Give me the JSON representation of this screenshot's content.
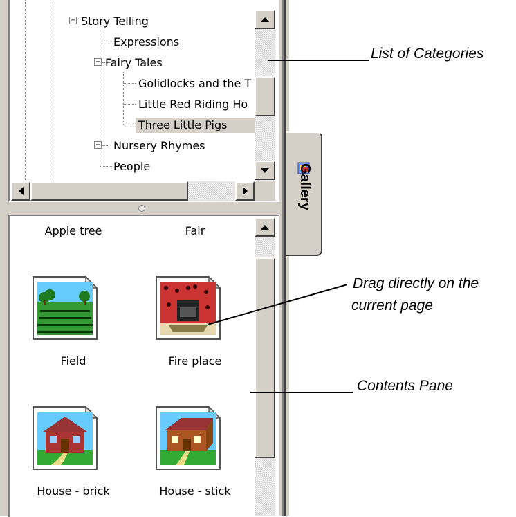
{
  "tree": {
    "items": [
      {
        "label": "Story Telling",
        "expander": "⊟"
      },
      {
        "label": "Expressions"
      },
      {
        "label": "Fairy Tales",
        "expander": "⊟"
      },
      {
        "label": "Golidlocks and the T"
      },
      {
        "label": "Little Red Riding Ho"
      },
      {
        "label": "Three Little Pigs",
        "selected": true
      },
      {
        "label": "Nursery Rhymes",
        "expander": "⊞"
      },
      {
        "label": "People"
      }
    ]
  },
  "gallery": {
    "tab_label": "Gallery",
    "tab_icon": "gallery-icon",
    "items": [
      {
        "caption": "Apple tree"
      },
      {
        "caption": "Fair"
      },
      {
        "caption": "Field",
        "icon": "field-clipart-icon"
      },
      {
        "caption": "Fire place",
        "icon": "fireplace-clipart-icon"
      },
      {
        "caption": "House - brick",
        "icon": "brick-house-clipart-icon"
      },
      {
        "caption": "House - stick",
        "icon": "stick-house-clipart-icon"
      }
    ]
  },
  "annotations": {
    "categories": "List of Categories",
    "drag_line1": "Drag directly on the",
    "drag_line2": "current page",
    "contents": "Contents Pane"
  },
  "colors": {
    "panel": "#d4d0c8",
    "selection": "#d4d0c8",
    "pane": "#ffffff"
  }
}
